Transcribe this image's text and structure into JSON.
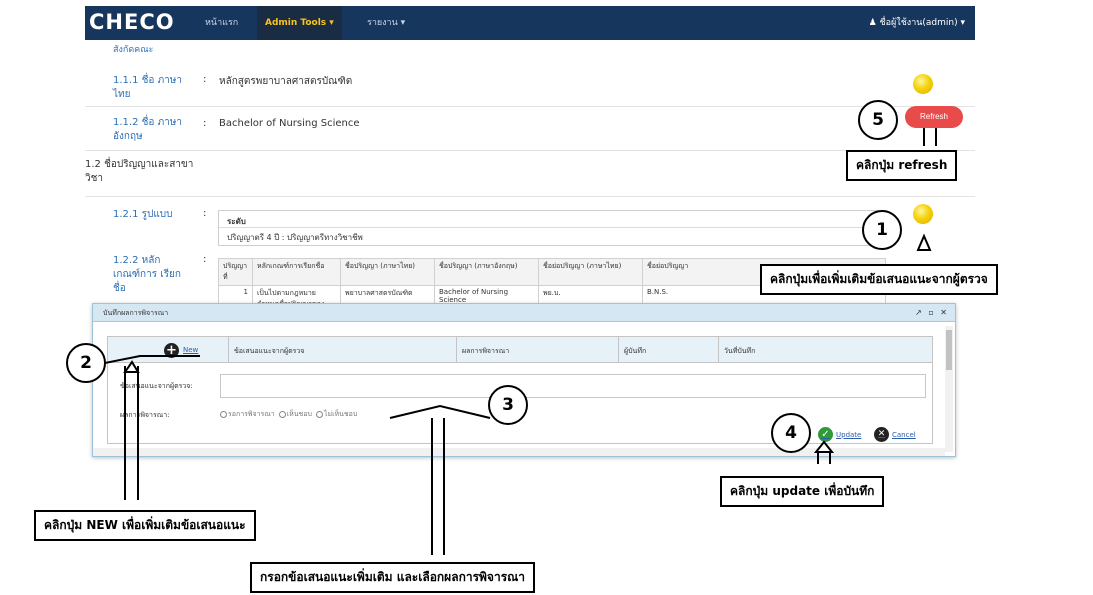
{
  "navbar": {
    "brand": "CHECO",
    "items": [
      "หน้าแรก",
      "Admin Tools ▾",
      "รายงาน ▾"
    ],
    "user": "♟ ชื่อผู้ใช้งาน(admin) ▾"
  },
  "content": {
    "section_cut": "สังกัดคณะ",
    "row_111_label": "1.1.1 ชื่อ ภาษาไทย",
    "row_111_value": "หลักสูตรพยาบาลศาสตรบัณฑิต",
    "row_112_label": "1.1.2 ชื่อ ภาษาอังกฤษ",
    "row_112_value": "Bachelor of Nursing Science",
    "row_12_label": "1.2 ชื่อปริญญาและสาขาวิชา",
    "row_121_label": "1.2.1 รูปแบบ",
    "fmt_title": "ระดับ",
    "fmt_value": "ปริญญาตรี 4 ปี : ปริญญาตรีทางวิชาชีพ",
    "row_122_label": "1.2.2 หลัก เกณฑ์การ เรียกชื่อ",
    "grid_headers": [
      "ปริญญาที่",
      "หลักเกณฑ์การเรียกชื่อ",
      "ชื่อปริญญา (ภาษาไทย)",
      "ชื่อปริญญา (ภาษาอังกฤษ)",
      "ชื่อย่อปริญญา (ภาษาไทย)",
      "ชื่อย่อปริญญา"
    ],
    "grid_row": [
      "1",
      "เป็นไปตามกฎหมายกำหนดชื่อปริญญาของ",
      "พยาบาลศาสตรบัณฑิต",
      "Bachelor of Nursing Science",
      "พย.บ.",
      "B.N.S."
    ],
    "refresh_label": "Refresh"
  },
  "dialog": {
    "title": "บันทึกผลการพิจารณา",
    "controls": "↗ ▫ ✕",
    "new_label": "New",
    "headers": [
      "ข้อเสนอแนะจากผู้ตรวจ",
      "ผลการพิจารณา",
      "ผู้บันทึก",
      "วันที่บันทึก"
    ],
    "suggestion_label": "ข้อเสนอแนะจากผู้ตรวจ:",
    "result_label": "ผลการพิจารณา:",
    "radio_options": [
      "รอการพิจารณา",
      "เห็นชอบ",
      "ไม่เห็นชอบ"
    ],
    "update_label": "Update",
    "cancel_label": "Cancel"
  },
  "annotations": {
    "c1": "1",
    "c2": "2",
    "c3": "3",
    "c4": "4",
    "c5": "5",
    "refresh_note": "คลิกปุ่ม refresh",
    "add_from_examiner": "คลิกปุ่มเพื่อเพิ่มเติมข้อเสนอแนะจากผู้ตรวจ",
    "update_note": "คลิกปุ่ม update เพื่อบันทึก",
    "new_note": "คลิกปุ่ม NEW เพื่อเพิ่มเติมข้อเสนอแนะ",
    "fill_note": "กรอกข้อเสนอแนะเพิ่มเติม และเลือกผลการพิจารณา"
  }
}
